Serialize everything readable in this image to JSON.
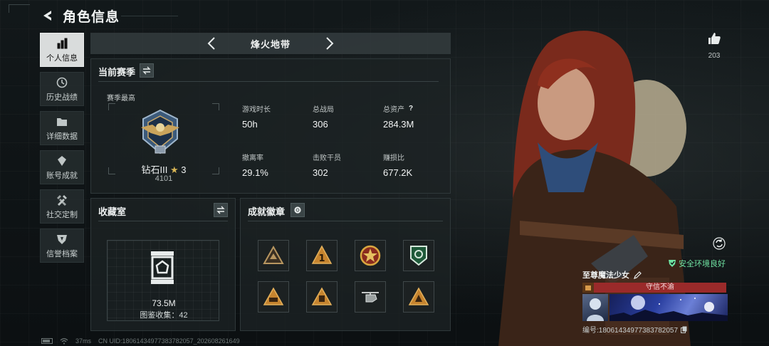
{
  "header": {
    "title": "角色信息"
  },
  "sidenav": {
    "items": [
      {
        "label": "个人信息",
        "icon": "bar-chart-icon",
        "active": true
      },
      {
        "label": "历史战绩",
        "icon": "history-icon",
        "active": false
      },
      {
        "label": "详细数据",
        "icon": "folder-icon",
        "active": false
      },
      {
        "label": "账号成就",
        "icon": "achievement-icon",
        "active": false
      },
      {
        "label": "社交定制",
        "icon": "tools-icon",
        "active": false
      },
      {
        "label": "信誉档案",
        "icon": "shield-icon",
        "active": false
      }
    ]
  },
  "map": {
    "name": "烽火地带"
  },
  "season": {
    "title": "当前赛季",
    "best_label": "赛季最高",
    "rank_name": "钻石III",
    "rank_star": "★",
    "rank_stars": "3",
    "rank_score": "4101",
    "stats": [
      {
        "label": "游戏时长",
        "value": "50h"
      },
      {
        "label": "总战局",
        "value": "306"
      },
      {
        "label": "总资产",
        "value": "284.3M",
        "help": "?"
      },
      {
        "label": "撤离率",
        "value": "29.1%"
      },
      {
        "label": "击败干员",
        "value": "302"
      },
      {
        "label": "赚损比",
        "value": "677.2K"
      }
    ]
  },
  "collection": {
    "title": "收藏室",
    "value": "73.5M",
    "count_label": "图鉴收集：42"
  },
  "achievements": {
    "title": "成就徽章"
  },
  "profile": {
    "likes": "203",
    "safe_env": "安全环境良好",
    "player_name": "至尊魔法少女",
    "credit_status": "守信不渝",
    "player_id": "编号:18061434977383782057"
  },
  "footer": {
    "ping": "37ms",
    "uid": "CN UID:18061434977383782057_202608261649"
  },
  "colors": {
    "accent_active": "#d9dcdc",
    "credit_red": "#9a2a2a",
    "safe_green": "#6fe3a2",
    "gold": "#d8b555"
  }
}
